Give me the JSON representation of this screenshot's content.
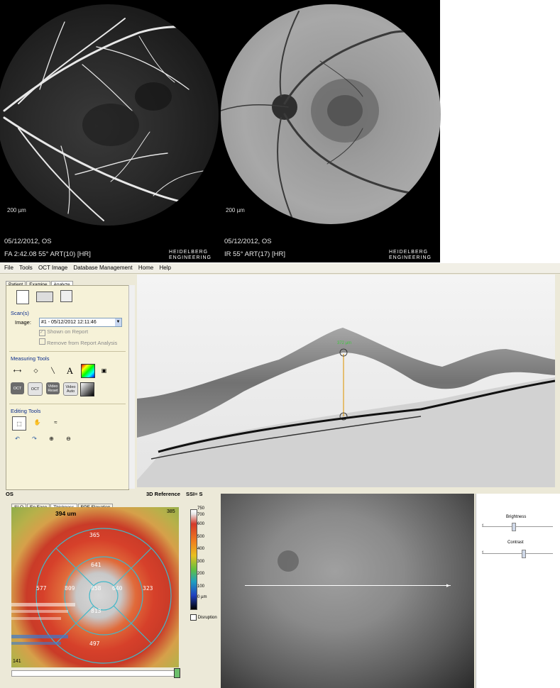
{
  "fundus": {
    "left": {
      "scale": "200 µm",
      "date": "05/12/2012, OS",
      "info": "FA 2:42.08 55° ART(10) [HR]"
    },
    "right": {
      "scale": "200 µm",
      "date": "05/12/2012, OS",
      "info": "IR 55° ART(17) [HR]"
    },
    "logo_top": "HEIDELBERG",
    "logo_bottom": "ENGINEERING"
  },
  "menu": [
    "File",
    "Tools",
    "OCT Image",
    "Database Management",
    "Home",
    "Help"
  ],
  "tabs": [
    "Patient",
    "Examine",
    "Analyze"
  ],
  "scans": {
    "section": "Scan(s)",
    "image_label": "Image:",
    "image_value": "#1 - 05/12/2012 12:11:46",
    "shown_on_report": "Shown on Report",
    "remove_from_report": "Remove from Report Analysis"
  },
  "measuring": {
    "section": "Measuring Tools",
    "text_tool": "A",
    "btn_oct1": "OCT",
    "btn_oct2": "OCT",
    "btn_video_reset": "Video Reset",
    "btn_video_auto": "Video Auto"
  },
  "editing": {
    "section": "Editing Tools"
  },
  "oct": {
    "measure_label": "372 µm"
  },
  "bottom": {
    "eye": "OS",
    "ref3d": "3D Reference",
    "ssi": "SSI= S",
    "thickness_tabs": [
      "SLO",
      "En Face",
      "Thickness",
      "RPE Elevation"
    ],
    "thickness_header": "394 um",
    "corner_top_right": "385",
    "corner_bottom_left": "141",
    "etdrs": {
      "outer_superior": "365",
      "inner_superior": "641",
      "outer_temporal": "577",
      "inner_temporal": "809",
      "center": "858",
      "inner_nasal": "640",
      "outer_nasal": "323",
      "inner_inferior": "813",
      "outer_inferior": "497"
    },
    "colorbar_labels": [
      "750",
      "700",
      "600",
      "500",
      "400",
      "300",
      "200",
      "100",
      "0 µm"
    ],
    "disruption": "Disruption",
    "brightness": "Brightness",
    "contrast": "Contrast"
  }
}
